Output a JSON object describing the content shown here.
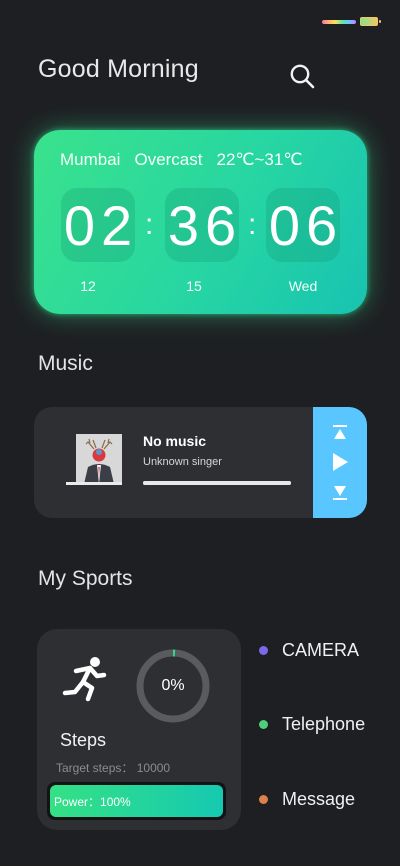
{
  "header": {
    "greeting": "Good Morning",
    "search_icon": "search-icon"
  },
  "weather": {
    "city": "Mumbai",
    "condition": "Overcast",
    "temp_range": "22℃~31℃"
  },
  "clock": {
    "hours": "02",
    "minutes": "36",
    "seconds": "06",
    "separator": ":",
    "month": "12",
    "day": "15",
    "weekday": "Wed"
  },
  "music": {
    "section_title": "Music",
    "song_title": "No music",
    "singer": "Unknown singer",
    "progress": 1.0,
    "controls": [
      "previous-icon",
      "play-icon",
      "next-icon"
    ],
    "accent_color": "#59c6ff"
  },
  "sports": {
    "section_title": "My Sports",
    "progress_percent": "0%",
    "steps_label": "Steps",
    "target_label": "Target steps：",
    "target_value": "10000",
    "power_label": "Power：100%",
    "power_level": 1.0,
    "icon": "running-person-icon"
  },
  "shortcuts": [
    {
      "label": "CAMERA",
      "color": "#7b68ee"
    },
    {
      "label": "Telephone",
      "color": "#4cd07d"
    },
    {
      "label": "Message",
      "color": "#d9824a"
    }
  ],
  "colors": {
    "background": "#1e1f22",
    "card": "#2e2f33",
    "clock_gradient_start": "#3ae28c",
    "clock_gradient_end": "#18c3b2"
  }
}
